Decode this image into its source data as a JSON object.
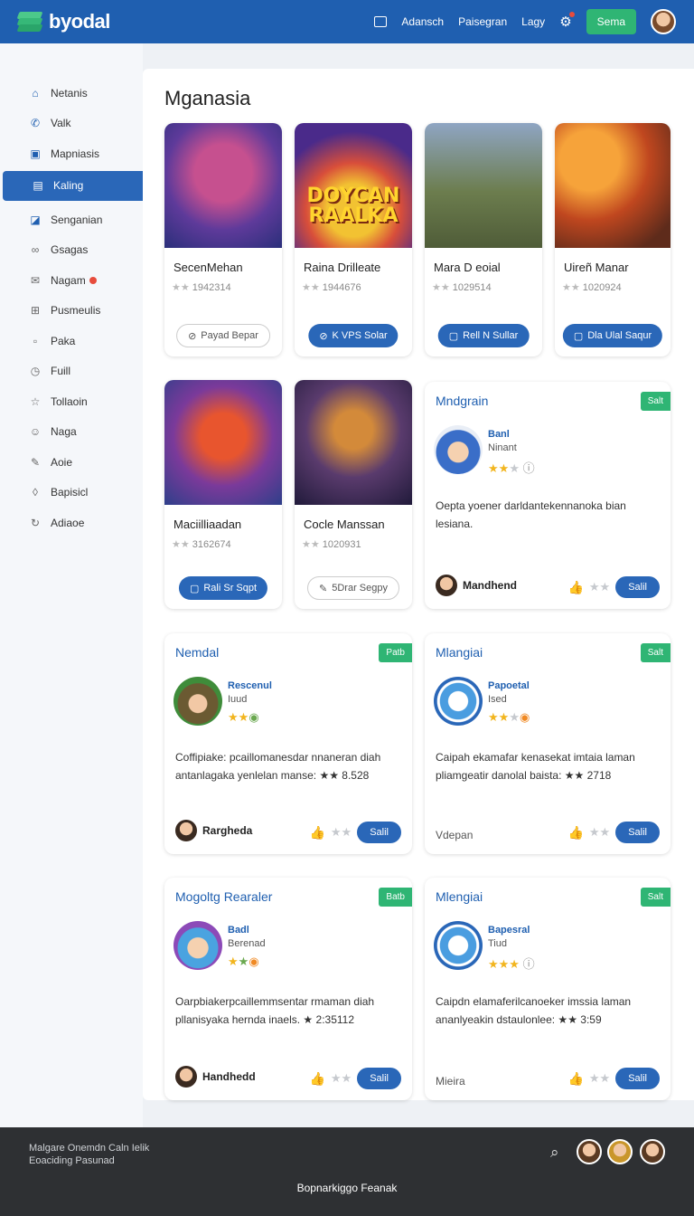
{
  "header": {
    "logo": "byodal",
    "nav": [
      "Adansch",
      "Paisegran",
      "Lagy"
    ],
    "cta": "Sema"
  },
  "sidebar": {
    "items": [
      {
        "label": "Netanis",
        "icon": "home-icon",
        "active": false
      },
      {
        "label": "Valk",
        "icon": "phone-icon",
        "active": false
      },
      {
        "label": "Mapniasis",
        "icon": "map-icon",
        "active": false
      },
      {
        "label": "Kaling",
        "icon": "book-icon",
        "active": true
      },
      {
        "label": "Senganian",
        "icon": "edit-icon",
        "active": false
      },
      {
        "label": "Gsagas",
        "icon": "link-icon",
        "active": false
      },
      {
        "label": "Nagam",
        "icon": "mail-icon",
        "active": false,
        "badge": true
      },
      {
        "label": "Pusmeulis",
        "icon": "grid-icon",
        "active": false
      },
      {
        "label": "Paka",
        "icon": "box-icon",
        "active": false
      },
      {
        "label": "Fuill",
        "icon": "clock-icon",
        "active": false
      },
      {
        "label": "Tollaoin",
        "icon": "star-icon",
        "active": false
      },
      {
        "label": "Naga",
        "icon": "smile-icon",
        "active": false
      },
      {
        "label": "Aoie",
        "icon": "pen-icon",
        "active": false
      },
      {
        "label": "Bapisicl",
        "icon": "drop-icon",
        "active": false
      },
      {
        "label": "Adiaoe",
        "icon": "refresh-icon",
        "active": false
      }
    ]
  },
  "main": {
    "title": "Mganasia",
    "games": [
      {
        "name": "SecenMehan",
        "meta": "1942314",
        "button": "Payad Bepar",
        "style": "ghost",
        "art_title": ""
      },
      {
        "name": "Raina Drilleate",
        "meta": "1944676",
        "button": "K VPS Solar",
        "style": "primary",
        "art_title": "DOYCAN RAALKA"
      },
      {
        "name": "Mara D eoial",
        "meta": "1029514",
        "button": "Rell N Sullar",
        "style": "primary",
        "art_title": ""
      },
      {
        "name": "Uireñ Manar",
        "meta": "1020924",
        "button": "Dla Ulal Saqur",
        "style": "primary",
        "art_title": ""
      },
      {
        "name": "Maciilliaadan",
        "meta": "3162674",
        "button": "Rali Sr Sqpt",
        "style": "primary",
        "art_title": ""
      },
      {
        "name": "Cocle Manssan",
        "meta": "1020931",
        "button": "5Drar Segpy",
        "style": "ghost",
        "art_title": ""
      }
    ],
    "reviews": [
      {
        "title": "Mndgrain",
        "tag": "Salt",
        "name": "Banl",
        "sub": "Ninant",
        "body": "Oepta yoener darldantekennanoka bian lesiana.",
        "user": "Mandhend",
        "user_plain": false,
        "action": "Salil"
      },
      {
        "title": "Nemdal",
        "tag": "Patb",
        "name": "Rescenul",
        "sub": "Iuud",
        "body": "Coffipiake: pcaillomanesdar nnaneran diah antanlagaka yenlelan manse: ★★ 8.528",
        "user": "Rargheda",
        "user_plain": false,
        "action": "Salil"
      },
      {
        "title": "Mlangiai",
        "tag": "Salt",
        "name": "Papoetal",
        "sub": "Ised",
        "body": "Caipah ekamafar kenasekat imtaia laman pliamgeatir danolal baista: ★★ 2718",
        "user": "Vdepan",
        "user_plain": true,
        "action": "Salil"
      },
      {
        "title": "Mogoltg Rearaler",
        "tag": "Batb",
        "name": "Badl",
        "sub": "Berenad",
        "body": "Oarpbiakerpcaillemmsentar rmaman diah pllanisyaka hernda inaels. ★ 2:35112",
        "user": "Handhedd",
        "user_plain": false,
        "action": "Salil"
      },
      {
        "title": "Mlengiai",
        "tag": "Salt",
        "name": "Bapesral",
        "sub": "Tiud",
        "body": "Caipdn elamaferilcanoeker imssia laman ananlyeakin dstaulonlee: ★★ 3:59",
        "user": "Mieira",
        "user_plain": true,
        "action": "Salil"
      }
    ]
  },
  "footer": {
    "line1": "Malgare Onemdn Caln Ielik",
    "line2": "Eoaciding Pasunad",
    "center": "Bopnarkiggo Feanak"
  }
}
